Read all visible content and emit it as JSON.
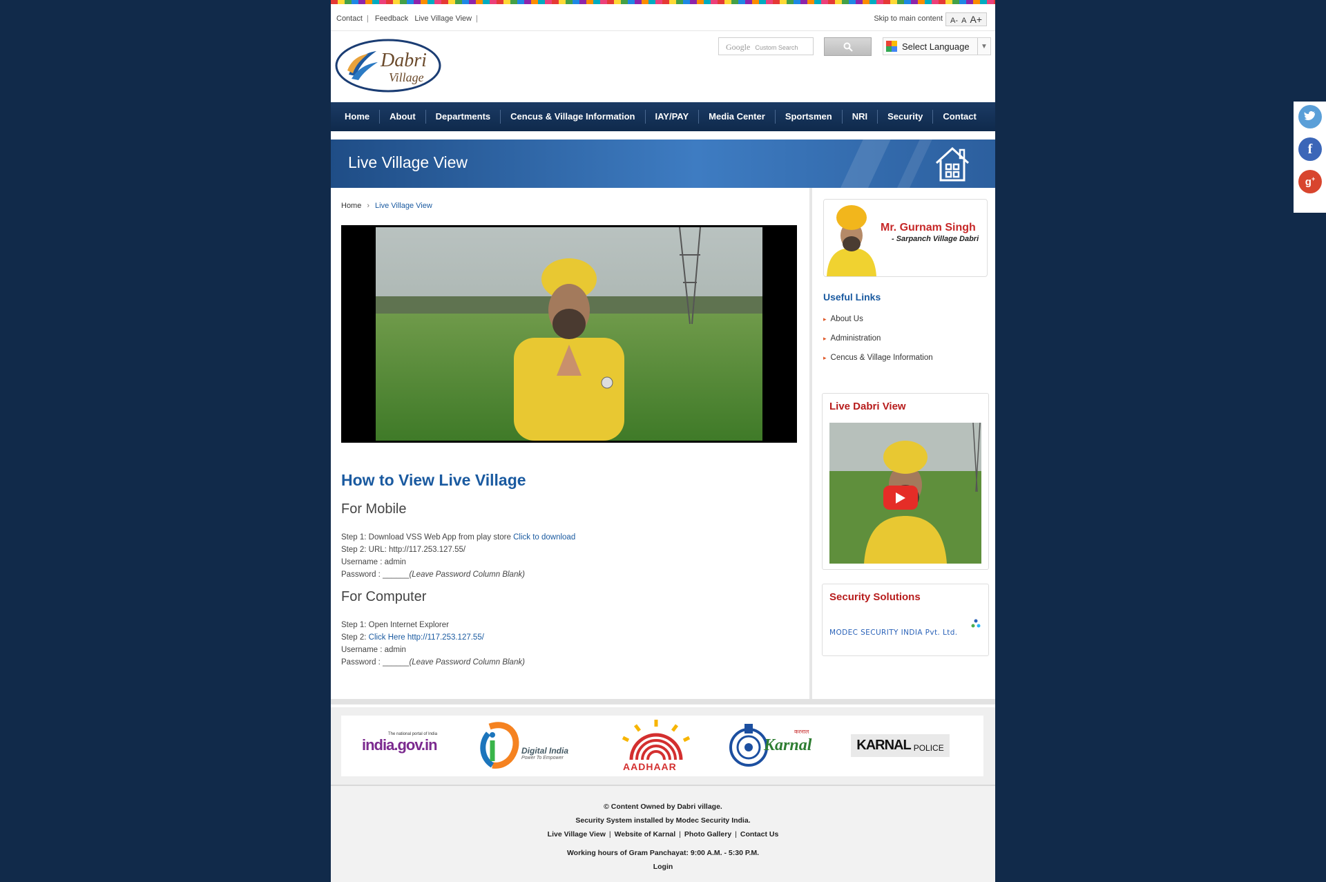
{
  "topbar": {
    "links": [
      "Contact",
      "Feedback",
      "Live Village View"
    ],
    "skip": "Skip to main content",
    "font_small": "A-",
    "font_normal": "A",
    "font_large": "A+"
  },
  "logo": {
    "line1": "Dabri",
    "line2": "Village"
  },
  "search": {
    "placeholder_google": "Google",
    "placeholder_text": "Custom Search"
  },
  "language": {
    "label": "Select Language"
  },
  "nav": [
    "Home",
    "About",
    "Departments",
    "Cencus & Village Information",
    "IAY/PAY",
    "Media Center",
    "Sportsmen",
    "NRI",
    "Security",
    "Contact"
  ],
  "banner": {
    "title": "Live Village View"
  },
  "breadcrumb": {
    "home": "Home",
    "current": "Live Village View"
  },
  "content": {
    "heading": "How to View Live Village",
    "mobile_heading": "For Mobile",
    "mobile_step1_text": "Step 1: Download VSS Web App from play store ",
    "mobile_step1_link": "Click to download",
    "mobile_step2": "Step 2: URL: http://117.253.127.55/",
    "mobile_username": "Username : admin",
    "mobile_password_prefix": "Password : ______",
    "mobile_password_note": "(Leave Password Column Blank)",
    "computer_heading": "For Computer",
    "computer_step1": "Step 1: Open Internet Explorer",
    "computer_step2_prefix": "Step 2: ",
    "computer_step2_link": "Click Here http://117.253.127.55/",
    "computer_username": "Username : admin",
    "computer_password_prefix": "Password : ______",
    "computer_password_note": "(Leave Password Column Blank)"
  },
  "sidebar": {
    "sarpanch_name": "Mr. Gurnam Singh",
    "sarpanch_title": "- Sarpanch Village Dabri",
    "useful_title": "Useful Links",
    "useful_links": [
      "About Us",
      "Administration",
      "Cencus & Village Information"
    ],
    "live_title": "Live Dabri View",
    "security_title": "Security Solutions",
    "security_brand": "MODEC SECURITY INDIA Pvt. Ltd."
  },
  "partners": {
    "india_gov_small": "The national portal of India",
    "india_gov": "india.gov.in",
    "digital_india": "Digital India",
    "digital_india_tag": "Power To Empower",
    "aadhaar": "AADHAAR",
    "karnal": "Karnal",
    "karnal_hindi": "करनाल",
    "karnal_police_main": "KARNAL",
    "karnal_police_sub": "POLICE"
  },
  "footer": {
    "line1": "© Content Owned by Dabri village.",
    "line2": "Security System installed by Modec Security India.",
    "links": [
      "Live Village View",
      "Website of Karnal",
      "Photo Gallery",
      "Contact Us"
    ],
    "hours": "Working hours of Gram Panchayat: 9:00 A.M. - 5:30 P.M.",
    "login": "Login"
  },
  "social": [
    "twitter-icon",
    "facebook-icon",
    "google-plus-icon"
  ],
  "colors": {
    "background": "#112a4a",
    "nav": "#1b3a64",
    "accent_blue": "#1a5aa0",
    "accent_red": "#b71c1c"
  }
}
